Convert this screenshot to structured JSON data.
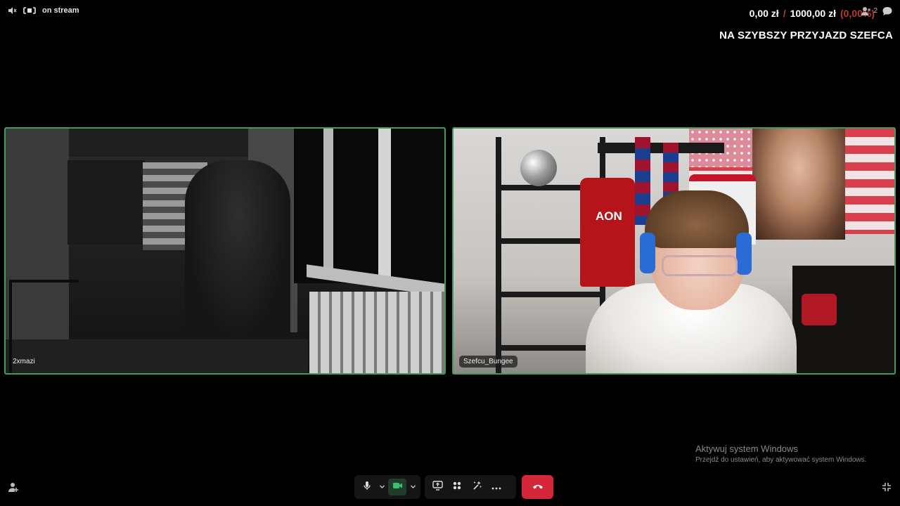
{
  "status_bar": {
    "stream_label": "on stream"
  },
  "overlay": {
    "current_amount": "0,00 zł",
    "separator": "/",
    "goal_amount": "1000,00 zł",
    "percent": "(0,00%)",
    "viewer_count": "2",
    "goal_title": "NA SZYBSZY PRZYJAZD SZEFCA"
  },
  "participants": [
    {
      "name": "2xmazi"
    },
    {
      "name": "Szefcu_Bungee"
    }
  ],
  "jersey_text": "AON",
  "watermark": {
    "line1": "Aktywuj system Windows",
    "line2": "Przejdź do ustawień, aby aktywować system Windows."
  },
  "colors": {
    "tile_border": "#3f9b5d",
    "leave_button": "#d4283a",
    "camera_active": "#3fbf6a",
    "accent_red": "#c0392b"
  },
  "icons": {
    "mute": "speaker-icon",
    "stream": "stream-icon",
    "viewers": "viewers-icon",
    "chat": "chat-icon",
    "mic": "microphone-icon",
    "camera": "camera-icon",
    "share": "screen-share-icon",
    "apps": "apps-icon",
    "effects": "effects-icon",
    "more": "more-icon",
    "leave": "phone-hangup-icon",
    "add_person": "add-person-icon",
    "collapse": "collapse-icon"
  }
}
